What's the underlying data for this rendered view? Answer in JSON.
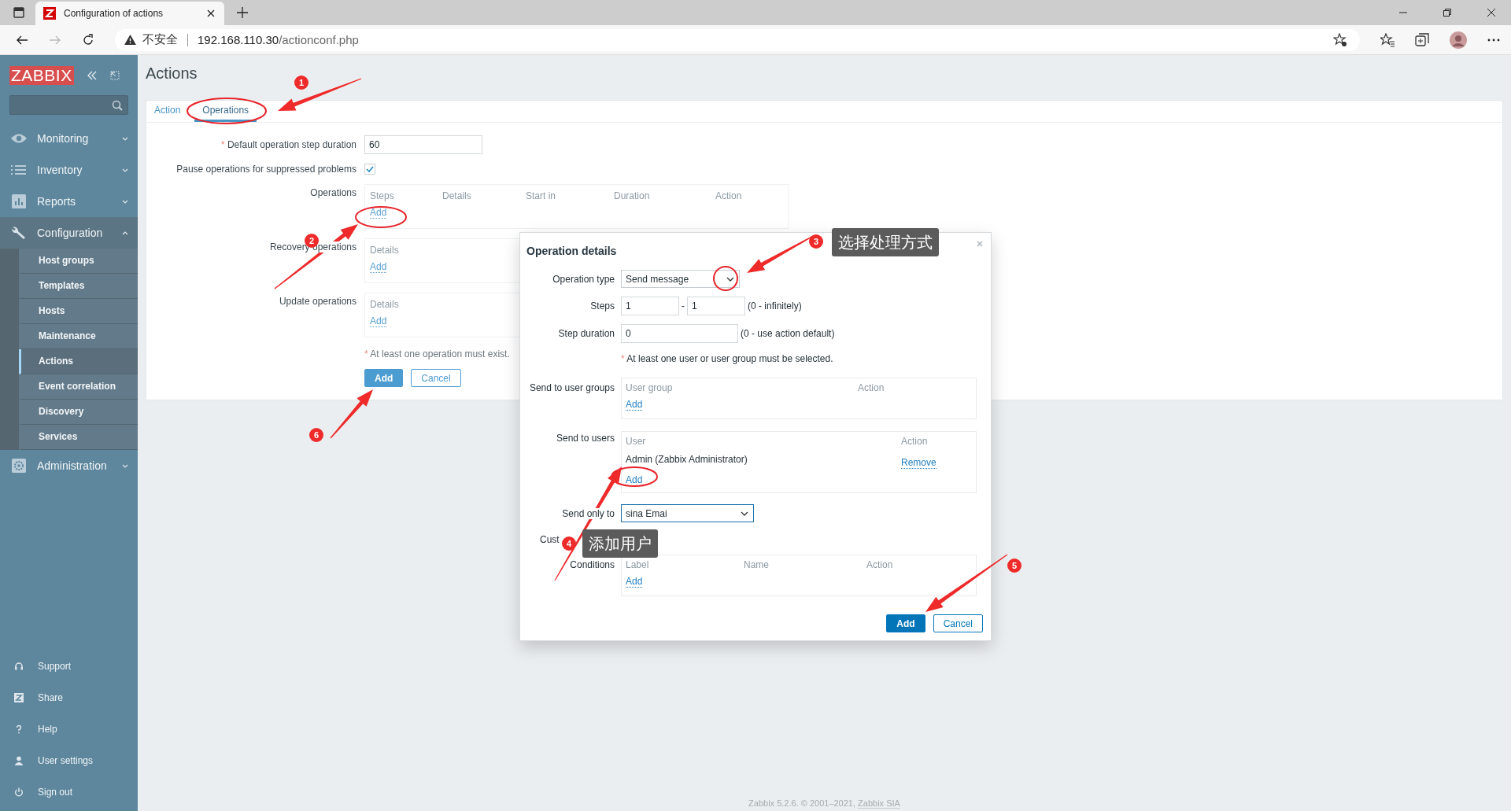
{
  "browser": {
    "tab_title": "Configuration of actions",
    "security": "不安全",
    "url_host": "192.168.110.30",
    "url_path": "/actionconf.php"
  },
  "sidebar": {
    "logo": "ZABBIX",
    "menu": [
      {
        "label": "Monitoring",
        "expanded": false
      },
      {
        "label": "Inventory",
        "expanded": false
      },
      {
        "label": "Reports",
        "expanded": false
      },
      {
        "label": "Configuration",
        "expanded": true,
        "children": [
          {
            "label": "Host groups",
            "selected": false
          },
          {
            "label": "Templates",
            "selected": false
          },
          {
            "label": "Hosts",
            "selected": false
          },
          {
            "label": "Maintenance",
            "selected": false
          },
          {
            "label": "Actions",
            "selected": true
          },
          {
            "label": "Event correlation",
            "selected": false
          },
          {
            "label": "Discovery",
            "selected": false
          },
          {
            "label": "Services",
            "selected": false
          }
        ]
      },
      {
        "label": "Administration",
        "expanded": false
      }
    ],
    "footer": [
      {
        "label": "Support"
      },
      {
        "label": "Share"
      },
      {
        "label": "Help"
      },
      {
        "label": "User settings"
      },
      {
        "label": "Sign out"
      }
    ]
  },
  "page": {
    "title": "Actions",
    "tabs": [
      {
        "label": "Action",
        "selected": false
      },
      {
        "label": "Operations",
        "selected": true
      }
    ],
    "form": {
      "step_duration": {
        "required_mark": "*",
        "label": "Default operation step duration",
        "value": "60"
      },
      "pause": {
        "label": "Pause operations for suppressed problems",
        "checked": true
      },
      "tables": [
        {
          "label": "Operations",
          "columns": [
            "Steps",
            "Details",
            "Start in",
            "Duration",
            "Action"
          ],
          "add_link": "Add"
        },
        {
          "label": "Recovery operations",
          "columns": [
            "Details"
          ],
          "add_link": "Add"
        },
        {
          "label": "Update operations",
          "columns": [
            "Details"
          ],
          "add_link": "Add"
        }
      ],
      "note": {
        "required_mark": "*",
        "text": "At least one operation must exist."
      },
      "buttons": [
        {
          "label": "Add",
          "kind": "primary"
        },
        {
          "label": "Cancel",
          "kind": "secondary"
        }
      ]
    }
  },
  "dialog": {
    "title": "Operation details",
    "operation_type": {
      "label": "Operation type",
      "value": "Send message"
    },
    "steps": {
      "label": "Steps",
      "from": "1",
      "separator": "-",
      "to": "1",
      "hint": "(0 - infinitely)"
    },
    "step_duration": {
      "label": "Step duration",
      "value": "0",
      "hint": "(0 - use action default)"
    },
    "note": {
      "required_mark": "*",
      "text": "At least one user or user group must be selected."
    },
    "user_groups": {
      "label": "Send to user groups",
      "columns": [
        "User group",
        "Action"
      ],
      "add_link": "Add"
    },
    "users": {
      "label": "Send to users",
      "columns": [
        "User",
        "Action"
      ],
      "rows": [
        {
          "name": "Admin (Zabbix Administrator)",
          "action": "Remove"
        }
      ],
      "add_link": "Add"
    },
    "send_only_to": {
      "label": "Send only to",
      "value": "sina Emai"
    },
    "custom_message": {
      "label": "Cust"
    },
    "conditions": {
      "label": "Conditions",
      "columns": [
        "Label",
        "Name",
        "Action"
      ],
      "add_link": "Add"
    },
    "buttons": [
      {
        "label": "Add",
        "kind": "primary"
      },
      {
        "label": "Cancel",
        "kind": "secondary"
      }
    ]
  },
  "footer": {
    "text": "Zabbix 5.2.6. © 2001–2021, ",
    "link": "Zabbix SIA"
  },
  "annotations": [
    {
      "number": "1"
    },
    {
      "number": "2"
    },
    {
      "number": "3",
      "callout": "选择处理方式"
    },
    {
      "number": "4",
      "callout": "添加用户"
    },
    {
      "number": "5"
    },
    {
      "number": "6"
    }
  ]
}
